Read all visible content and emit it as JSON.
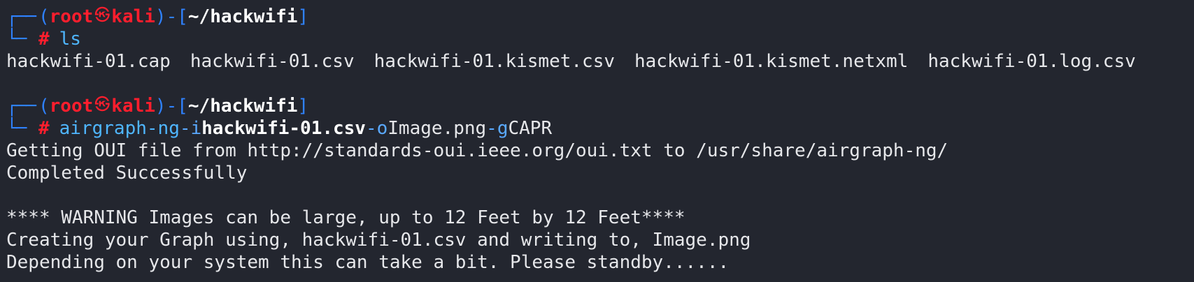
{
  "prompt": {
    "top_left": "┌──",
    "bottom_left": "└─",
    "open_paren": "(",
    "user": "root",
    "skull": "㉿",
    "host": "kali",
    "close_paren": ")-[",
    "path": "~/hackwifi",
    "close_bracket": "]",
    "symbol": "#"
  },
  "commands": [
    {
      "cmd": "ls"
    },
    {
      "cmd": "airgraph-ng",
      "flag1": "-i",
      "arg1": "hackwifi-01.csv",
      "flag2": "-o",
      "arg2": "Image.png",
      "flag3": "-g",
      "arg3": "CAPR"
    }
  ],
  "ls_output": [
    "hackwifi-01.cap",
    "hackwifi-01.csv",
    "hackwifi-01.kismet.csv",
    "hackwifi-01.kismet.netxml",
    "hackwifi-01.log.csv"
  ],
  "airgraph_output": [
    "Getting OUI file from http://standards-oui.ieee.org/oui.txt to /usr/share/airgraph-ng/",
    "Completed Successfully",
    "",
    "**** WARNING Images can be large, up to 12 Feet by 12 Feet****",
    "Creating your Graph using, hackwifi-01.csv and writing to, Image.png",
    "Depending on your system this can take a bit. Please standby......"
  ]
}
